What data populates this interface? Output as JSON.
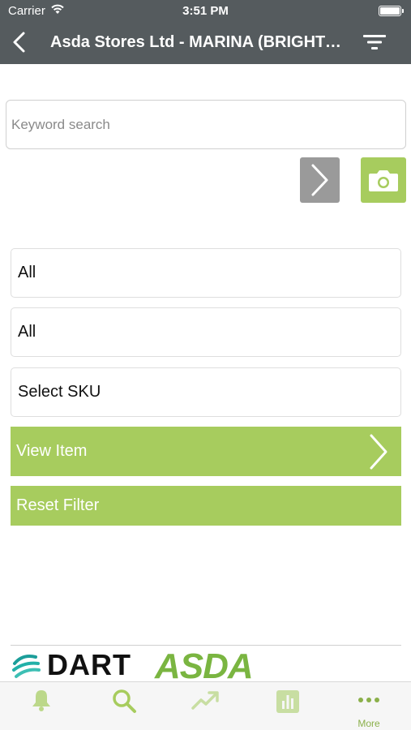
{
  "status_bar": {
    "carrier": "Carrier",
    "time": "3:51 PM"
  },
  "nav": {
    "title": "Asda Stores Ltd - MARINA (BRIGHTON)"
  },
  "search": {
    "placeholder": "Keyword search"
  },
  "selectors": [
    {
      "value": "All"
    },
    {
      "value": "All"
    },
    {
      "value": "Select SKU"
    }
  ],
  "actions": {
    "view_item": "View Item",
    "reset_filter": "Reset Filter"
  },
  "footer": {
    "dart_logo_text": "DART",
    "asda_logo_text": "ASDA"
  },
  "tabs": [
    {
      "icon": "bell-icon",
      "label": ""
    },
    {
      "icon": "search-icon",
      "label": ""
    },
    {
      "icon": "trend-icon",
      "label": ""
    },
    {
      "icon": "bar-chart-icon",
      "label": ""
    },
    {
      "icon": "more-icon",
      "label": "More"
    }
  ],
  "colors": {
    "accent": "#a7cc5e",
    "header": "#555b5e",
    "disabled": "#9a9a9a"
  }
}
